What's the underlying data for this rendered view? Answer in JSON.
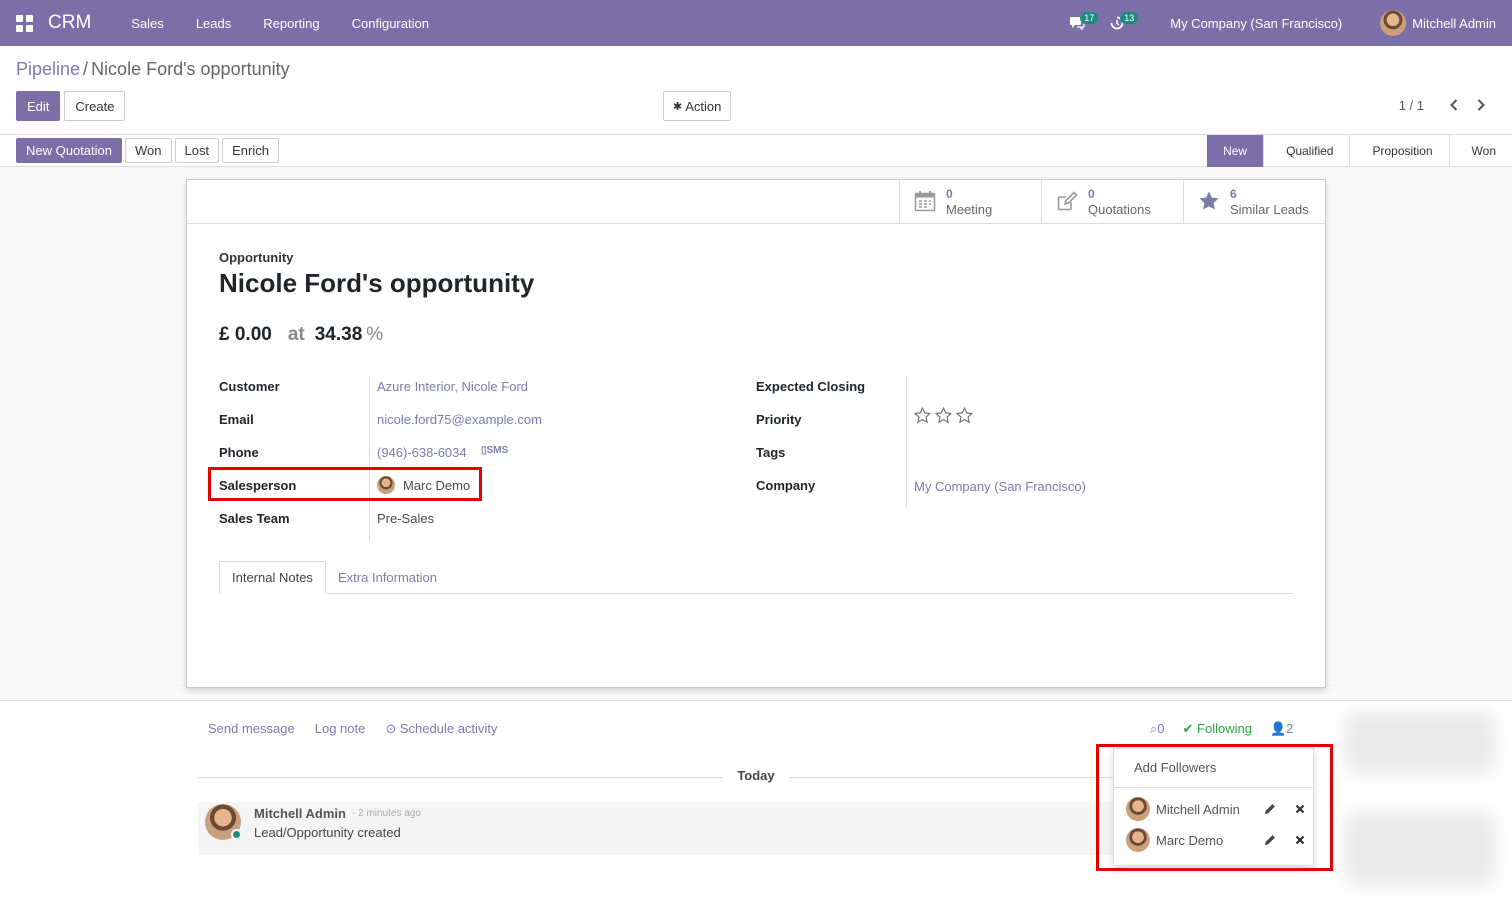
{
  "navbar": {
    "app_name": "CRM",
    "menu": [
      "Sales",
      "Leads",
      "Reporting",
      "Configuration"
    ],
    "messages_count": "17",
    "activities_count": "13",
    "company": "My Company (San Francisco)",
    "user": "Mitchell Admin"
  },
  "breadcrumb": {
    "parent": "Pipeline",
    "separator": "/",
    "current": "Nicole Ford's opportunity"
  },
  "toolbar": {
    "edit": "Edit",
    "create": "Create",
    "action": "Action",
    "pager": "1 / 1"
  },
  "statusbar": {
    "buttons": [
      "New Quotation",
      "Won",
      "Lost",
      "Enrich"
    ],
    "stages": [
      "New",
      "Qualified",
      "Proposition",
      "Won"
    ],
    "active_stage": "New"
  },
  "smart_buttons": [
    {
      "count": "0",
      "label": "Meeting",
      "icon": "calendar-icon"
    },
    {
      "count": "0",
      "label": "Quotations",
      "icon": "edit-icon"
    },
    {
      "count": "6",
      "label": "Similar Leads",
      "icon": "star-icon"
    }
  ],
  "record": {
    "type_label": "Opportunity",
    "name": "Nicole Ford's opportunity",
    "revenue": "£ 0.00",
    "at_label": "at",
    "probability": "34.38",
    "pct_sign": "%"
  },
  "fields_left": {
    "customer_label": "Customer",
    "customer": "Azure Interior, Nicole Ford",
    "email_label": "Email",
    "email": "nicole.ford75@example.com",
    "phone_label": "Phone",
    "phone": "(946)-638-6034",
    "sms": "SMS",
    "salesperson_label": "Salesperson",
    "salesperson": "Marc Demo",
    "team_label": "Sales Team",
    "team": "Pre-Sales"
  },
  "fields_right": {
    "closing_label": "Expected Closing",
    "closing": "",
    "priority_label": "Priority",
    "priority_stars": 0,
    "priority_max": 3,
    "tags_label": "Tags",
    "company_label": "Company",
    "company": "My Company (San Francisco)"
  },
  "tabs": [
    "Internal Notes",
    "Extra Information"
  ],
  "chatter": {
    "send_message": "Send message",
    "log_note": "Log note",
    "schedule": "Schedule activity",
    "attachments": "0",
    "following": "Following",
    "followers_count": "2",
    "date_separator": "Today",
    "messages": [
      {
        "author": "Mitchell Admin",
        "time": "- 2 minutes ago",
        "body": "Lead/Opportunity created"
      }
    ]
  },
  "followers_dropdown": {
    "add": "Add Followers",
    "followers": [
      "Mitchell Admin",
      "Marc Demo"
    ]
  },
  "colors": {
    "brand": "#7c6ea7",
    "link": "#7c7bad",
    "highlight": "#e40000",
    "success": "#28a745"
  }
}
